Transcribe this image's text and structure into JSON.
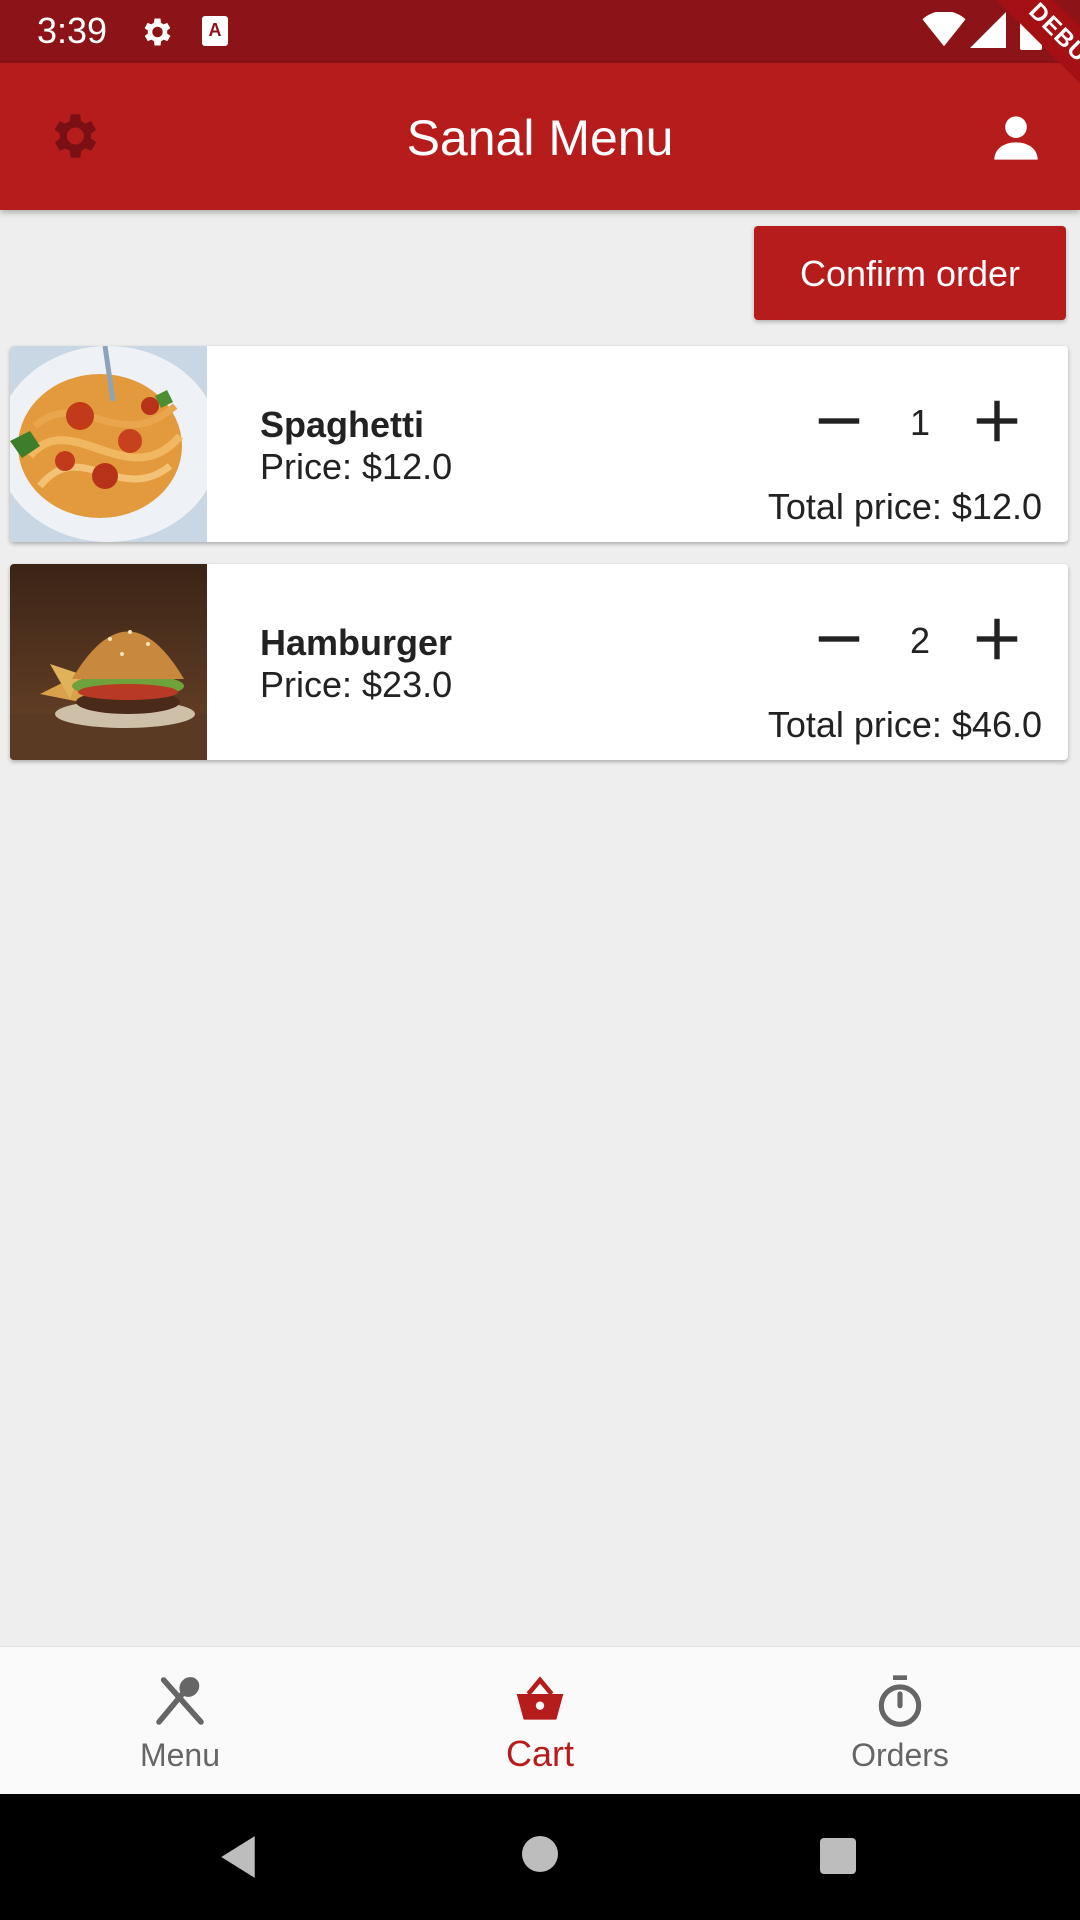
{
  "status_bar": {
    "time": "3:39"
  },
  "app_bar": {
    "title": "Sanal Menu",
    "debug_label": "DEBUG"
  },
  "actions": {
    "confirm_label": "Confirm order"
  },
  "cart": {
    "items": [
      {
        "name": "Spaghetti",
        "price_label": "Price: $12.0",
        "quantity": "1",
        "total_label": "Total price: $12.0"
      },
      {
        "name": "Hamburger",
        "price_label": "Price: $23.0",
        "quantity": "2",
        "total_label": "Total price: $46.0"
      }
    ]
  },
  "bottom_nav": {
    "items": [
      {
        "label": "Menu",
        "icon": "fork-spoon-icon",
        "active": false
      },
      {
        "label": "Cart",
        "icon": "basket-icon",
        "active": true
      },
      {
        "label": "Orders",
        "icon": "timer-icon",
        "active": false
      }
    ]
  },
  "colors": {
    "primary": "#b71c1c",
    "status_bar": "#8c1317",
    "background": "#eeeeee"
  }
}
